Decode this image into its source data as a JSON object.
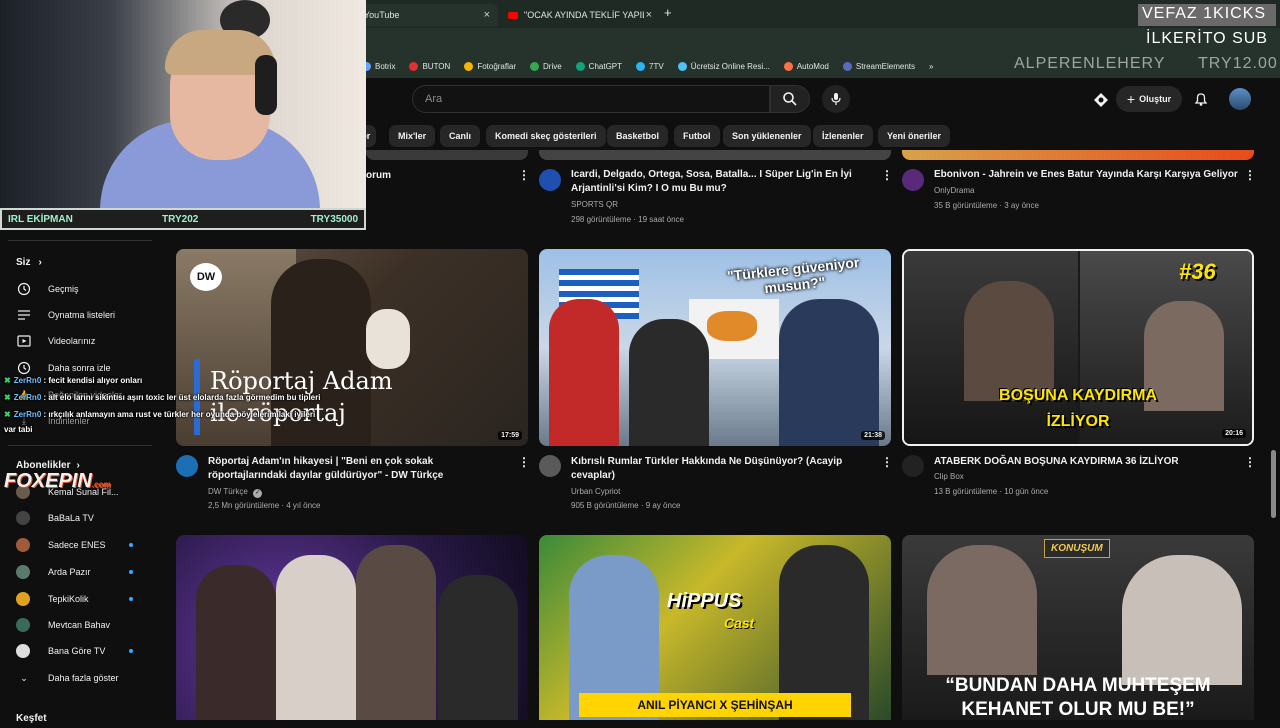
{
  "browser": {
    "tabs": [
      {
        "label": "YouTube",
        "active": true
      },
      {
        "label": "\"OCAK AYINDA TEKLİF YAPILAC",
        "active": false
      }
    ],
    "new_tab": "+",
    "bookmarks": [
      "Botrix",
      "BUTON",
      "Fotoğraflar",
      "Drive",
      "ChatGPT",
      "7TV",
      "Ücretsiz Online Resi...",
      "AutoMod",
      "StreamElements"
    ],
    "bookmarks_more": "»"
  },
  "header": {
    "search_placeholder": "Ara",
    "create_label": "Oluştur"
  },
  "chips": [
    "er",
    "Mix'ler",
    "Canlı",
    "Komedi skeç gösterileri",
    "Basketbol",
    "Futbol",
    "Son yüklenenler",
    "İzlenenler",
    "Yeni öneriler"
  ],
  "sidebar": {
    "you_label": "Siz",
    "items": [
      {
        "label": "Geçmiş",
        "icon": "history-icon"
      },
      {
        "label": "Oynatma listeleri",
        "icon": "playlist-icon"
      },
      {
        "label": "Videolarınız",
        "icon": "your-videos-icon"
      },
      {
        "label": "Daha sonra izle",
        "icon": "watch-later-icon"
      },
      {
        "label": "Beğenilen videolar",
        "icon": "like-icon"
      },
      {
        "label": "İndirilenler",
        "icon": "download-icon"
      }
    ],
    "subs_title": "Abonelikler",
    "subs": [
      {
        "label": "Kemal Sunal Fil...",
        "color": "#6b5b4a",
        "live": false
      },
      {
        "label": "BaBaLa TV",
        "color": "#444444",
        "live": false
      },
      {
        "label": "Sadece ENES",
        "color": "#a05a3a",
        "live": true
      },
      {
        "label": "Arda Pazır",
        "color": "#5a7a6a",
        "live": true
      },
      {
        "label": "TepkiKolik",
        "color": "#e0a020",
        "live": true
      },
      {
        "label": "Mevtcan Bahav",
        "color": "#3a6a5a",
        "live": false
      },
      {
        "label": "Bana Göre TV",
        "color": "#dddddd",
        "live": true
      }
    ],
    "more_label": "Daha fazla göster",
    "explore_label": "Keşfet"
  },
  "videos_top": [
    {
      "title_tail": "orum"
    },
    {
      "title": "Icardi, Delgado, Ortega, Sosa, Batalla... I Süper Lig'in En İyi Arjantinli'si Kim? I O mu Bu mu?",
      "channel": "SPORTS QR",
      "meta": "298 görüntüleme · 19 saat önce",
      "avatar": "#1f4fb0"
    },
    {
      "title": "Ebonivon - Jahrein ve Enes Batur Yayında Karşı Karşıya Geliyor",
      "channel": "OnlyDrama",
      "meta": "35 B görüntüleme · 3 ay önce",
      "avatar": "#5a2a7a"
    }
  ],
  "videos_mid": [
    {
      "thumb_text_1": "Röportaj Adam",
      "thumb_text_2": "ile röportaj",
      "dw": "DW",
      "duration": "17:59",
      "title": "Röportaj Adam'ın hikayesi | \"Beni en çok sokak röportajlarındaki dayılar güldürüyor\" - DW Türkçe",
      "channel": "DW Türkçe",
      "verified": "✓",
      "meta": "2,5 Mn görüntüleme · 4 yıl önce",
      "avatar": "#1b6fb5"
    },
    {
      "thumb_text": "\"Türklere güveniyor musun?\"",
      "duration": "21:38",
      "title": "Kıbrıslı Rumlar Türkler Hakkında Ne Düşünüyor? (Acayip cevaplar)",
      "channel": "Urban Cypriot",
      "meta": "905 B görüntüleme · 9 ay önce",
      "avatar": "#5a5a5a"
    },
    {
      "thumb_badge": "#36",
      "thumb_text_1": "BOŞUNA KAYDIRMA",
      "thumb_text_2": "İZLİYOR",
      "duration": "20:16",
      "title": "ATABERK DOĞAN BOŞUNA KAYDIRMA 36 İZLİYOR",
      "channel": "Clip Box",
      "meta": "13 B görüntüleme · 10 gün önce",
      "avatar": "#222222"
    }
  ],
  "videos_bottom": [
    {
      "thumb_text": ""
    },
    {
      "thumb_logo_1": "HiPPUS",
      "thumb_logo_2": "Cast",
      "thumb_text": "ANIL PİYANCI X ŞEHİNŞAH"
    },
    {
      "thumb_logo": "KONUŞUM",
      "thumb_text_1": "“BUNDAN DAHA MUHTEŞEM",
      "thumb_text_2": "KEHANET OLUR MU BE!”"
    }
  ],
  "overlay": {
    "panel_left": "IRL EKİPMAN",
    "panel_mid": "TRY202",
    "panel_right": "TRY35000",
    "top_right_1": "VEFAZ 1KICKS",
    "top_right_2": "İLKERİTO SUB",
    "top_right_3": "ALPERENLEHERY",
    "top_right_4": "TRY12.00",
    "sponsor": "FOXEPIN",
    "sponsor_tld": ".com",
    "chat": [
      {
        "user": "ZerRn0",
        "msg": " : fecit kendisi alıyor onları"
      },
      {
        "user": "ZerRn0",
        "msg": " : alt elo larını sikintısı aşırı toxic ler üst elolarda fazla görmedim bu tipleri"
      },
      {
        "user": "ZerRn0",
        "msg": " : ırkçılık anlamayın ama rust ve türkler her oyunda böylelerimilaki iyileri"
      }
    ],
    "chat_wrap": "var tabi"
  }
}
